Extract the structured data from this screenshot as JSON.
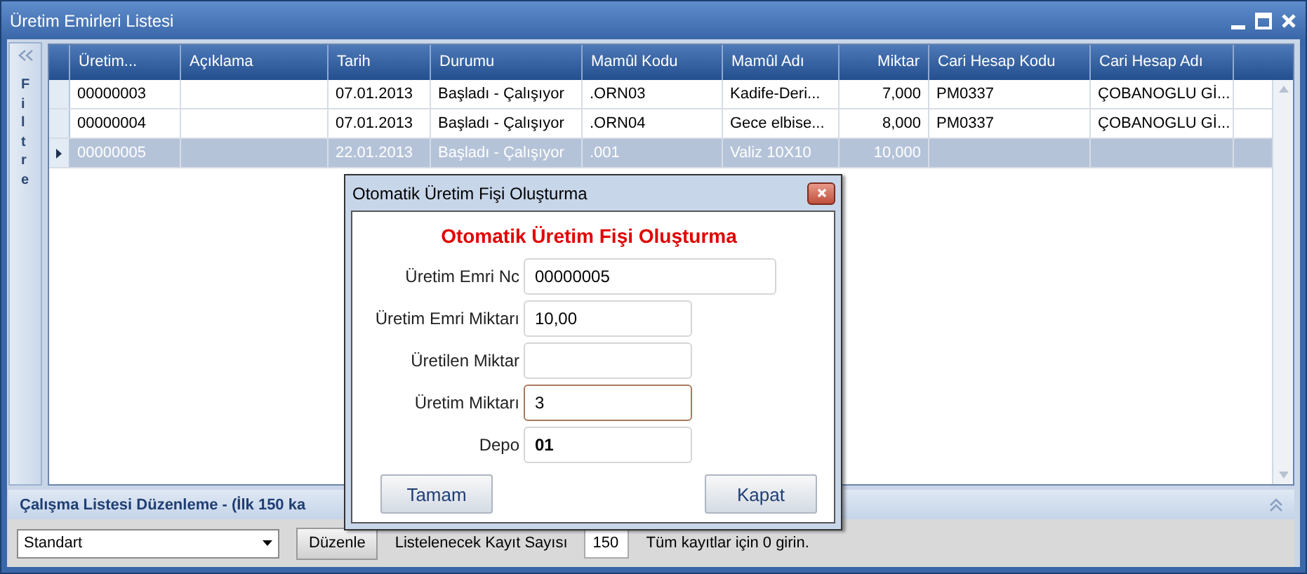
{
  "window": {
    "title": "Üretim Emirleri Listesi"
  },
  "filter_panel": {
    "label": "Filtre"
  },
  "grid": {
    "columns": [
      {
        "label": "Üretim...",
        "kind": "text"
      },
      {
        "label": "Açıklama",
        "kind": "text"
      },
      {
        "label": "Tarih",
        "kind": "text"
      },
      {
        "label": "Durumu",
        "kind": "text"
      },
      {
        "label": "Mamûl Kodu",
        "kind": "text"
      },
      {
        "label": "Mamûl Adı",
        "kind": "text"
      },
      {
        "label": "Miktar",
        "kind": "number"
      },
      {
        "label": "Cari Hesap Kodu",
        "kind": "text"
      },
      {
        "label": "Cari Hesap Adı",
        "kind": "text"
      }
    ],
    "rows": [
      {
        "cells": [
          "00000003",
          "",
          "07.01.2013",
          "Başladı - Çalışıyor",
          ".ORN03",
          "Kadife-Deri...",
          "7,000",
          "PM0337",
          "ÇOBANOGLU Gİ..."
        ],
        "selected": false
      },
      {
        "cells": [
          "00000004",
          "",
          "07.01.2013",
          "Başladı - Çalışıyor",
          ".ORN04",
          "Gece elbise...",
          "8,000",
          "PM0337",
          "ÇOBANOGLU Gİ..."
        ],
        "selected": false
      },
      {
        "cells": [
          "00000005",
          "",
          "22.01.2013",
          "Başladı - Çalışıyor",
          ".001",
          "Valiz 10X10",
          "10,000",
          "",
          ""
        ],
        "selected": true
      }
    ]
  },
  "bottom_panel": {
    "title": "Çalışma Listesi Düzenleme - (İlk 150 ka",
    "view": "Standart",
    "edit_button": "Düzenle",
    "count_label": "Listelenecek Kayıt Sayısı",
    "count": "150",
    "hint": "Tüm kayıtlar için 0 girin."
  },
  "dialog": {
    "title": "Otomatik Üretim Fişi Oluşturma",
    "heading": "Otomatik Üretim Fişi Oluşturma",
    "fields": [
      {
        "label": "Üretim Emri Nc",
        "value": "00000005",
        "focused": false,
        "wide": true
      },
      {
        "label": "Üretim Emri Miktarı",
        "value": "10,00",
        "focused": false,
        "wide": false
      },
      {
        "label": "Üretilen Miktar",
        "focused": false,
        "wide": false
      },
      {
        "label": "Üretim Miktarı",
        "value": "3",
        "focused": true,
        "wide": false
      },
      {
        "label": "Depo",
        "value": "01",
        "focused": false,
        "wide": false
      }
    ],
    "buttons": [
      {
        "label": "Tamam",
        "kind": "ok"
      },
      {
        "label": "Kapat",
        "kind": "cancel"
      }
    ]
  }
}
